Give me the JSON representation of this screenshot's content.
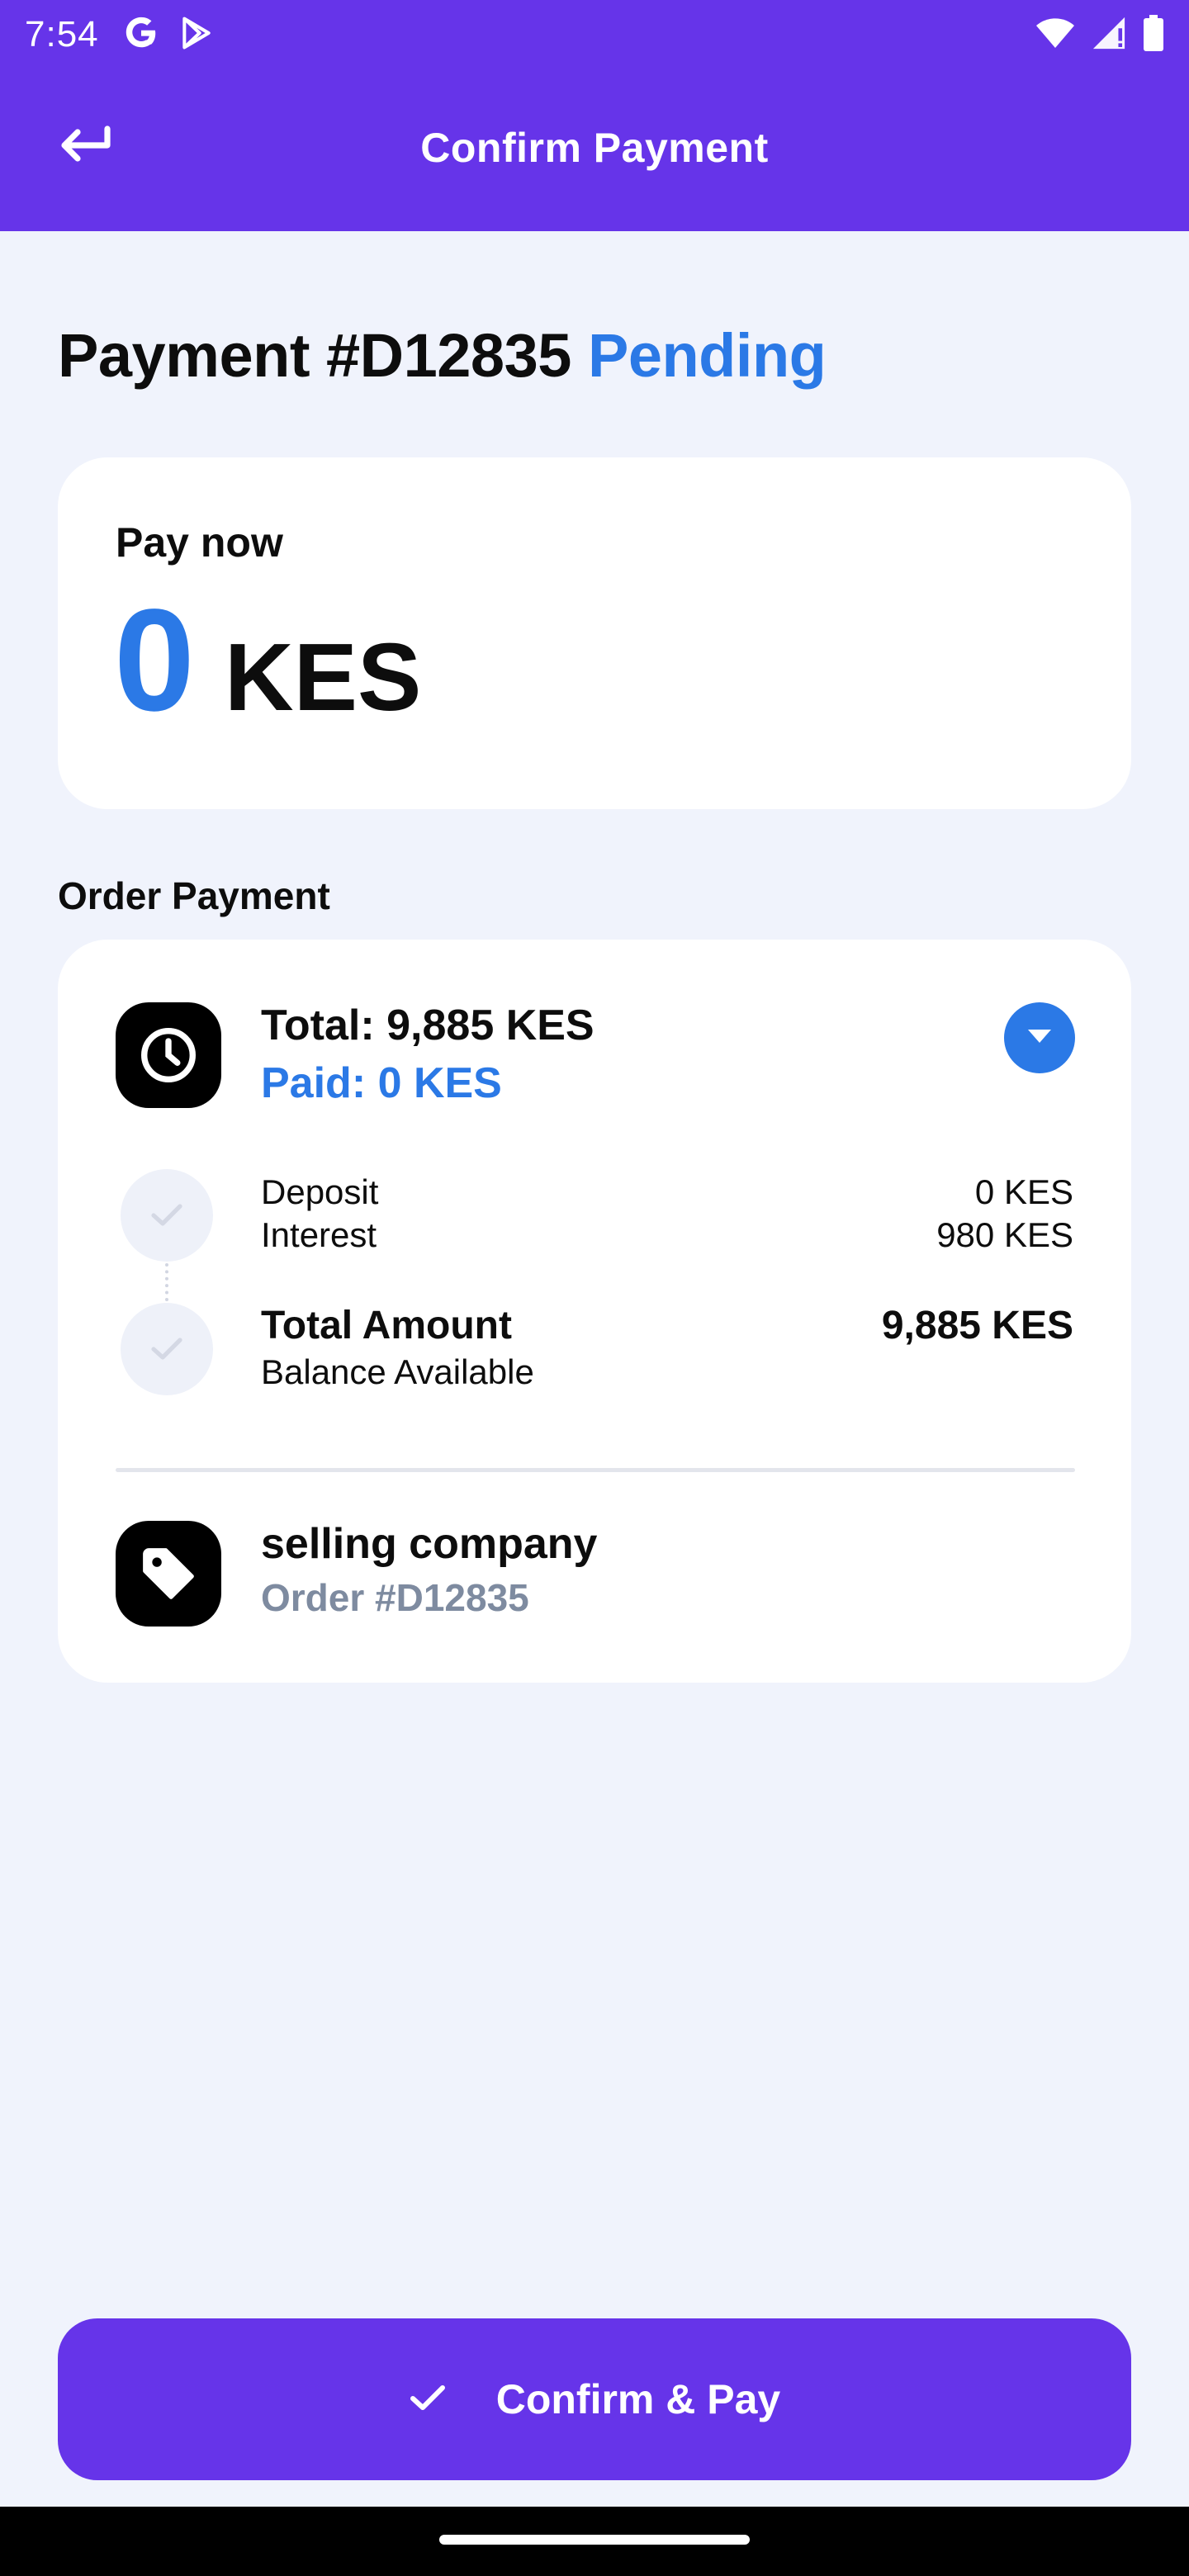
{
  "status_bar": {
    "time": "7:54",
    "icons": [
      "google-icon",
      "play-store-icon",
      "wifi-icon",
      "cell-signal-icon",
      "battery-icon"
    ]
  },
  "app_bar": {
    "title": "Confirm Payment",
    "back_icon": "back-arrow-icon"
  },
  "payment": {
    "heading": "Payment #D12835",
    "status": "Pending"
  },
  "pay_now": {
    "label": "Pay now",
    "amount": "0",
    "currency": "KES"
  },
  "order_payment": {
    "section_label": "Order Payment",
    "total": "Total: 9,885 KES",
    "paid": "Paid: 0 KES",
    "rows": {
      "deposit_label": "Deposit",
      "deposit_value": "0 KES",
      "interest_label": "Interest",
      "interest_value": "980 KES",
      "total_amount_label": "Total Amount",
      "total_amount_value": "9,885 KES",
      "balance_label": "Balance Available"
    },
    "seller": {
      "name": "selling company",
      "order": "Order #D12835"
    }
  },
  "actions": {
    "confirm_label": "Confirm & Pay"
  },
  "colors": {
    "primary": "#6634e9",
    "accent": "#2b79e6",
    "background": "#f0f3fc",
    "muted": "#7e8ba0"
  }
}
